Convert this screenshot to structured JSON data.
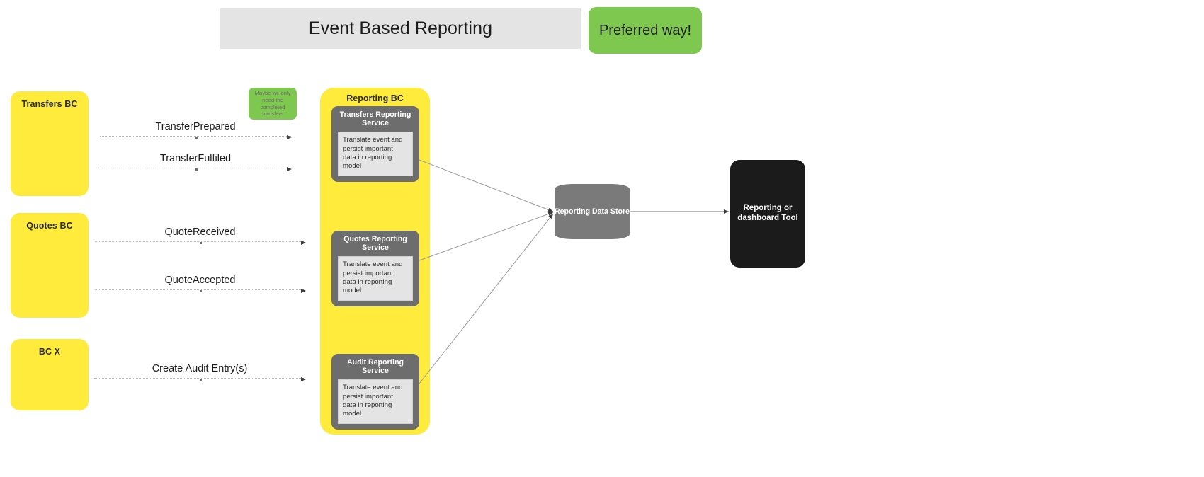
{
  "header": {
    "title": "Event Based Reporting",
    "badge": "Preferred way!"
  },
  "sticky_note": {
    "text": "Maybe we only need the completed transfers"
  },
  "left_contexts": [
    {
      "label": "Transfers BC",
      "events": [
        "TransferPrepared",
        "TransferFulfiled"
      ]
    },
    {
      "label": "Quotes BC",
      "events": [
        "QuoteReceived",
        "QuoteAccepted"
      ]
    },
    {
      "label": "BC X",
      "events": [
        "Create Audit Entry(s)"
      ]
    }
  ],
  "reporting_bc": {
    "title": "Reporting BC",
    "services": [
      {
        "title": "Transfers Reporting Service",
        "body": "Translate event and persist important data in reporting model"
      },
      {
        "title": "Quotes Reporting Service",
        "body": "Translate event and persist important data in reporting model"
      },
      {
        "title": "Audit Reporting Service",
        "body": "Translate event and persist important data in reporting model"
      }
    ]
  },
  "data_store": {
    "label": "Reporting Data Store"
  },
  "tool": {
    "label": "Reporting or dashboard Tool"
  },
  "colors": {
    "context_yellow": "#ffeb3c",
    "accent_green": "#7ec850",
    "service_gray": "#6d6d6d",
    "store_gray": "#7a7a7a",
    "tool_black": "#1b1b1b",
    "banner_gray": "#e4e4e4"
  }
}
